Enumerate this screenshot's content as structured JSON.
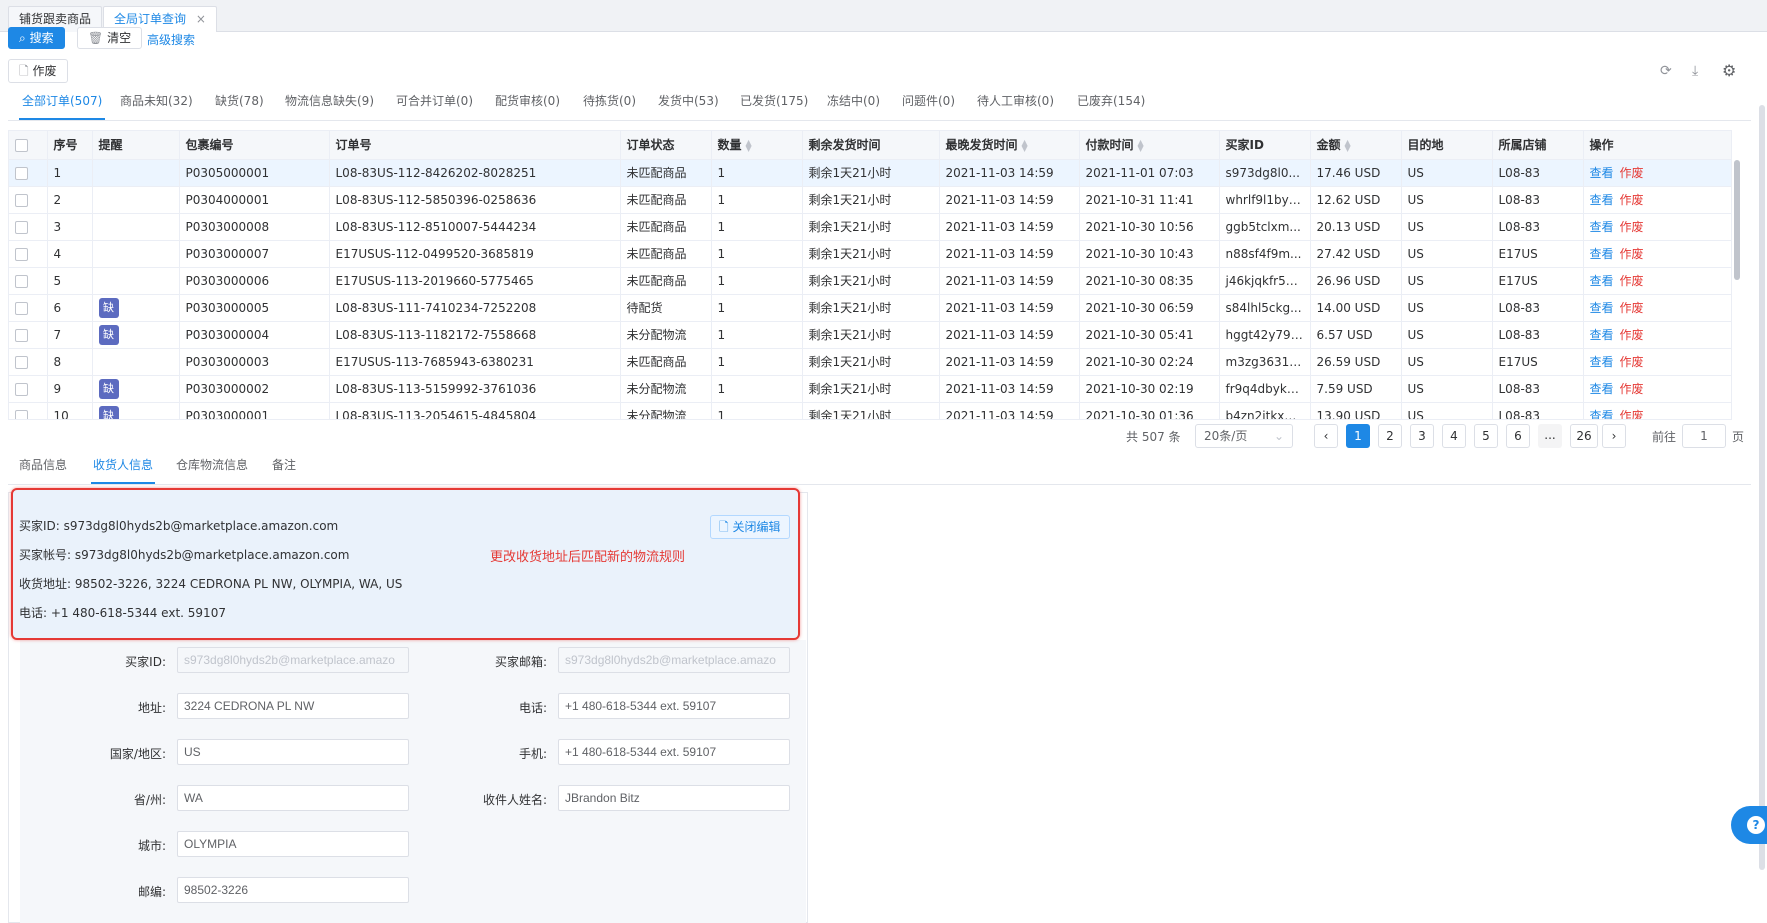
{
  "page_tabs": [
    {
      "label": "铺货跟卖商品",
      "active": false
    },
    {
      "label": "全局订单查询",
      "active": true
    }
  ],
  "toolbar": {
    "search_label": "搜索",
    "clear_label": "清空",
    "advanced_label": "高级搜索",
    "void_label": "作废"
  },
  "status_tabs": [
    {
      "label": "全部订单(507)",
      "active": true
    },
    {
      "label": "商品未知(32)"
    },
    {
      "label": "缺货(78)"
    },
    {
      "label": "物流信息缺失(9)"
    },
    {
      "label": "可合并订单(0)"
    },
    {
      "label": "配货审核(0)"
    },
    {
      "label": "待拣货(0)"
    },
    {
      "label": "发货中(53)"
    },
    {
      "label": "已发货(175)"
    },
    {
      "label": "冻结中(0)"
    },
    {
      "label": "问题件(0)"
    },
    {
      "label": "待人工审核(0)"
    },
    {
      "label": "已废弃(154)"
    }
  ],
  "table": {
    "columns": [
      "序号",
      "提醒",
      "包裹编号",
      "订单号",
      "订单状态",
      "数量",
      "剩余发货时间",
      "最晚发货时间",
      "付款时间",
      "买家ID",
      "金额",
      "目的地",
      "所属店铺",
      "操作"
    ],
    "action_view": "查看",
    "action_void": "作废",
    "rows": [
      {
        "no": "1",
        "alert": "",
        "package": "P0305000001",
        "order": "L08-83US-112-8426202-8028251",
        "status": "未匹配商品",
        "qty": "1",
        "remain": "剩余1天21小时",
        "latest": "2021-11-03 14:59",
        "paid": "2021-11-01 07:03",
        "buyer": "s973dg8l0...",
        "amount": "17.46 USD",
        "dest": "US",
        "shop": "L08-83",
        "selected": true
      },
      {
        "no": "2",
        "alert": "",
        "package": "P0304000001",
        "order": "L08-83US-112-5850396-0258636",
        "status": "未匹配商品",
        "qty": "1",
        "remain": "剩余1天21小时",
        "latest": "2021-11-03 14:59",
        "paid": "2021-10-31 11:41",
        "buyer": "whrlf9l1by2...",
        "amount": "12.62 USD",
        "dest": "US",
        "shop": "L08-83"
      },
      {
        "no": "3",
        "alert": "",
        "package": "P0303000008",
        "order": "L08-83US-112-8510007-5444234",
        "status": "未匹配商品",
        "qty": "1",
        "remain": "剩余1天21小时",
        "latest": "2021-11-03 14:59",
        "paid": "2021-10-30 10:56",
        "buyer": "ggb5tclxm...",
        "amount": "20.13 USD",
        "dest": "US",
        "shop": "L08-83"
      },
      {
        "no": "4",
        "alert": "",
        "package": "P0303000007",
        "order": "E17USUS-112-0499520-3685819",
        "status": "未匹配商品",
        "qty": "1",
        "remain": "剩余1天21小时",
        "latest": "2021-11-03 14:59",
        "paid": "2021-10-30 10:43",
        "buyer": "n88sf4f9m...",
        "amount": "27.42 USD",
        "dest": "US",
        "shop": "E17US"
      },
      {
        "no": "5",
        "alert": "",
        "package": "P0303000006",
        "order": "E17USUS-113-2019660-5775465",
        "status": "未匹配商品",
        "qty": "1",
        "remain": "剩余1天21小时",
        "latest": "2021-11-03 14:59",
        "paid": "2021-10-30 08:35",
        "buyer": "j46kjqkfr53...",
        "amount": "26.96 USD",
        "dest": "US",
        "shop": "E17US"
      },
      {
        "no": "6",
        "alert": "缺",
        "package": "P0303000005",
        "order": "L08-83US-111-7410234-7252208",
        "status": "待配货",
        "qty": "1",
        "remain": "剩余1天21小时",
        "latest": "2021-11-03 14:59",
        "paid": "2021-10-30 06:59",
        "buyer": "s84lhl5ckg...",
        "amount": "14.00 USD",
        "dest": "US",
        "shop": "L08-83"
      },
      {
        "no": "7",
        "alert": "缺",
        "package": "P0303000004",
        "order": "L08-83US-113-1182172-7558668",
        "status": "未分配物流",
        "qty": "1",
        "remain": "剩余1天21小时",
        "latest": "2021-11-03 14:59",
        "paid": "2021-10-30 05:41",
        "buyer": "hggt42y79t...",
        "amount": "6.57 USD",
        "dest": "US",
        "shop": "L08-83"
      },
      {
        "no": "8",
        "alert": "",
        "package": "P0303000003",
        "order": "E17USUS-113-7685943-6380231",
        "status": "未匹配商品",
        "qty": "1",
        "remain": "剩余1天21小时",
        "latest": "2021-11-03 14:59",
        "paid": "2021-10-30 02:24",
        "buyer": "m3zg36315...",
        "amount": "26.59 USD",
        "dest": "US",
        "shop": "E17US"
      },
      {
        "no": "9",
        "alert": "缺",
        "package": "P0303000002",
        "order": "L08-83US-113-5159992-3761036",
        "status": "未分配物流",
        "qty": "1",
        "remain": "剩余1天21小时",
        "latest": "2021-11-03 14:59",
        "paid": "2021-10-30 02:19",
        "buyer": "fr9q4dbyk3...",
        "amount": "7.59 USD",
        "dest": "US",
        "shop": "L08-83"
      },
      {
        "no": "10",
        "alert": "缺",
        "package": "P0303000001",
        "order": "L08-83US-113-2054615-4845804",
        "status": "未分配物流",
        "qty": "1",
        "remain": "剩余1天21小时",
        "latest": "2021-11-03 14:59",
        "paid": "2021-10-30 01:36",
        "buyer": "b4zn2itkxm...",
        "amount": "13.90 USD",
        "dest": "US",
        "shop": "L08-83"
      }
    ]
  },
  "pagination": {
    "total": "共 507 条",
    "page_size": "20条/页",
    "pages": [
      "1",
      "2",
      "3",
      "4",
      "5",
      "6",
      "...",
      "26"
    ],
    "current": "1",
    "goto_label": "前往",
    "goto_value": "1",
    "page_unit": "页"
  },
  "detail_tabs": [
    {
      "label": "商品信息"
    },
    {
      "label": "收货人信息",
      "active": true
    },
    {
      "label": "仓库物流信息"
    },
    {
      "label": "备注"
    }
  ],
  "info_box": {
    "buyer_id": "买家ID: s973dg8l0hyds2b@marketplace.amazon.com",
    "buyer_account": "买家帐号: s973dg8l0hyds2b@marketplace.amazon.com",
    "address": "收货地址: 98502-3226, 3224 CEDRONA PL NW, OLYMPIA, WA, US",
    "phone": "电话: +1 480-618-5344 ext. 59107",
    "close_edit_label": "关闭编辑",
    "annotation": "更改收货地址后匹配新的物流规则"
  },
  "form": {
    "buyer_id_label": "买家ID:",
    "buyer_id_value": "s973dg8l0hyds2b@marketplace.amazo",
    "email_label": "买家邮箱:",
    "email_value": "s973dg8l0hyds2b@marketplace.amazo",
    "address_label": "地址:",
    "address_value": "3224 CEDRONA PL NW",
    "phone_label": "电话:",
    "phone_value": "+1 480-618-5344 ext. 59107",
    "country_label": "国家/地区:",
    "country_value": "US",
    "mobile_label": "手机:",
    "mobile_value": "+1 480-618-5344 ext. 59107",
    "state_label": "省/州:",
    "state_value": "WA",
    "receiver_label": "收件人姓名:",
    "receiver_value": "JBrandon Bitz",
    "city_label": "城市:",
    "city_value": "OLYMPIA",
    "zip_label": "邮编:",
    "zip_value": "98502-3226"
  },
  "colors": {
    "accent": "#1e88e5",
    "danger": "#e53935",
    "alert_badge": "#5c6bc0",
    "annotation_border": "#e53935"
  },
  "icons": [
    "search-icon",
    "trash-icon",
    "document-icon",
    "refresh-icon",
    "download-icon",
    "gear-icon",
    "help-icon",
    "close-icon",
    "chevron-left-icon",
    "chevron-right-icon"
  ]
}
